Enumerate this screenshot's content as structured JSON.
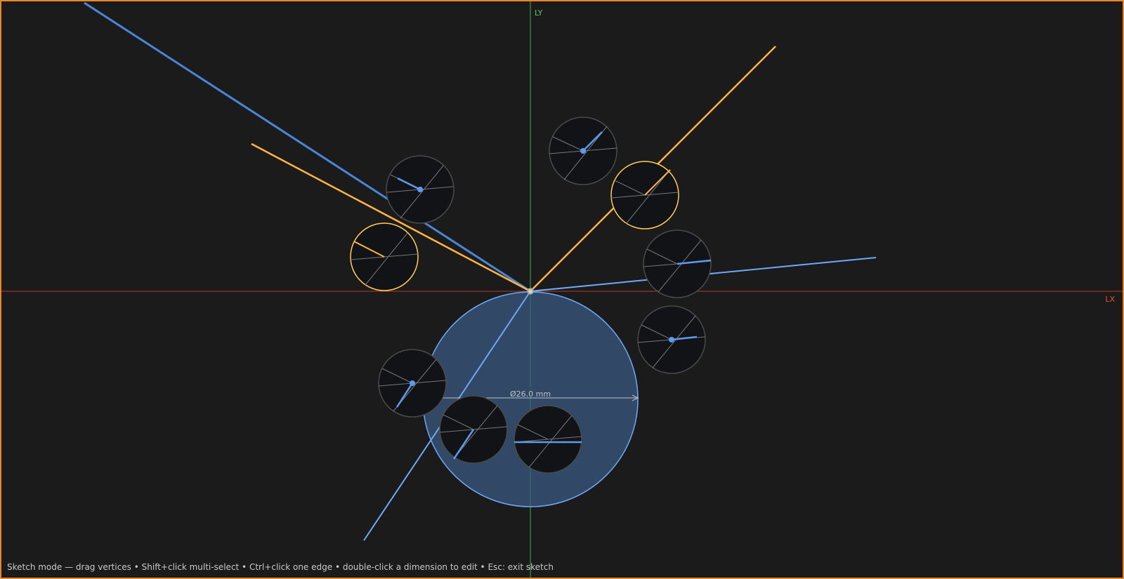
{
  "viewport": {
    "axis_x_label": "LX",
    "axis_y_label": "LY",
    "colors": {
      "frame": "#e8862a",
      "background": "#1b1b1b",
      "axis_x": "#c0392b",
      "axis_y": "#3fae49",
      "selected_edge": "#ffb347",
      "edge": "#5b9cf0",
      "circle_fill": "#3a5a80",
      "widget_fill": "#121317"
    }
  },
  "sketch": {
    "diameter_dimension": "Ø26.0 mm"
  },
  "status_bar": {
    "text": "Sketch mode — drag vertices • Shift+click multi-select • Ctrl+click one edge • double-click a dimension to edit • Esc: exit sketch"
  }
}
